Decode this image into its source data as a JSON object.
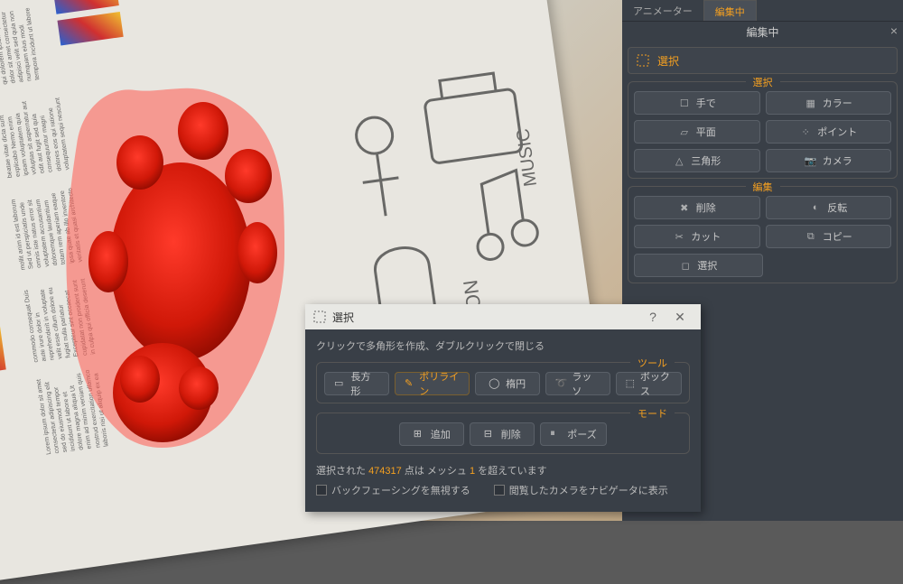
{
  "tabs": {
    "animator": "アニメーター",
    "editing": "編集中"
  },
  "panel": {
    "title": "編集中",
    "selection": {
      "label": "選択"
    },
    "select_group_title": "選択",
    "select_buttons": {
      "by_hand": "手で",
      "color": "カラー",
      "plane": "平面",
      "point": "ポイント",
      "triangle": "三角形",
      "camera": "カメラ"
    },
    "edit_group_title": "編集",
    "edit_buttons": {
      "delete": "削除",
      "invert": "反転",
      "cut": "カット",
      "copy": "コピー",
      "select": "選択"
    }
  },
  "dialog": {
    "title": "選択",
    "hint": "クリックで多角形を作成、ダブルクリックで閉じる",
    "tool_group_title": "ツール",
    "tool_buttons": {
      "rectangle": "長方形",
      "polyline": "ポリライン",
      "ellipse": "楕円",
      "lasso": "ラッソ",
      "box": "ボックス"
    },
    "mode_group_title": "モード",
    "mode_buttons": {
      "add": "追加",
      "remove": "削除",
      "pose": "ポーズ"
    },
    "status": {
      "prefix": "選択された ",
      "count": "474317",
      "middle": " 点は メッシュ ",
      "mesh_n": "1",
      "suffix": " を超えています"
    },
    "checks": {
      "ignore_backfacing": "バックフェーシングを無視する",
      "browse_camera_nav": "閲覧したカメラをナビゲータに表示"
    }
  }
}
